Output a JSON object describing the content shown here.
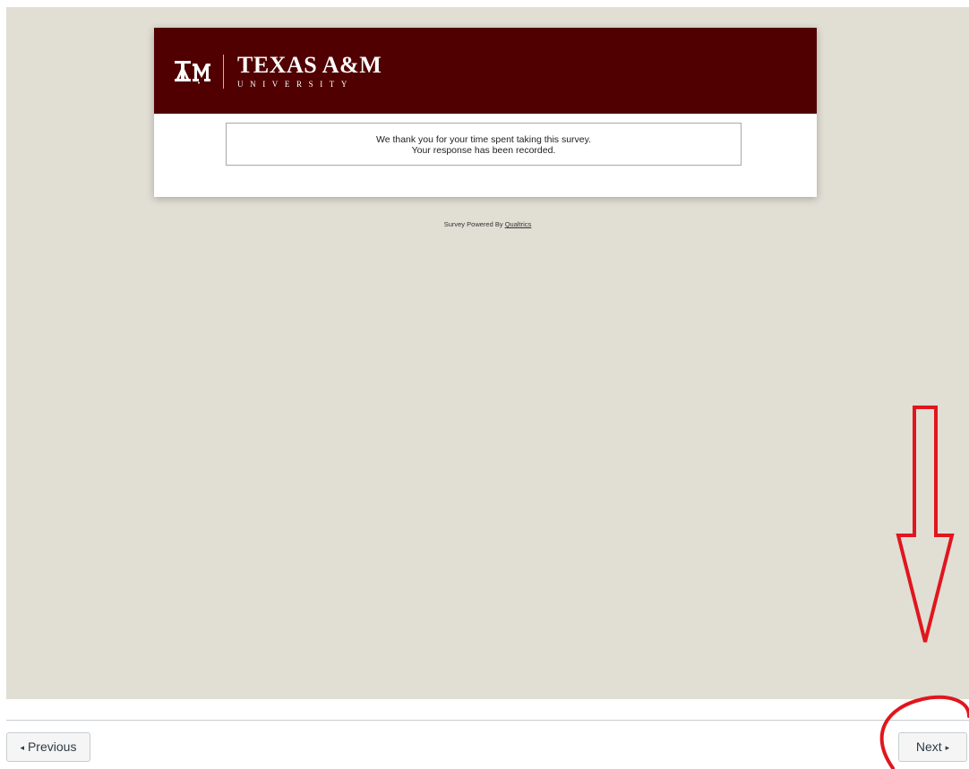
{
  "brand": {
    "title": "TEXAS A&M",
    "subtitle": "UNIVERSITY",
    "color": "#500000"
  },
  "message": {
    "line1": "We thank you for your time spent taking this survey.",
    "line2": "Your response has been recorded."
  },
  "footer": {
    "powered_by_prefix": "Survey Powered By",
    "powered_by_link": "Qualtrics"
  },
  "navigation": {
    "previous_label": "Previous",
    "next_label": "Next",
    "previous_icon": "triangle-left-icon",
    "next_icon": "triangle-right-icon"
  },
  "annotation": {
    "color": "#e0161e",
    "shapes": [
      "down-arrow",
      "circle"
    ]
  },
  "colors": {
    "content_background": "#e1ded4",
    "button_text": "#2d3b45"
  }
}
